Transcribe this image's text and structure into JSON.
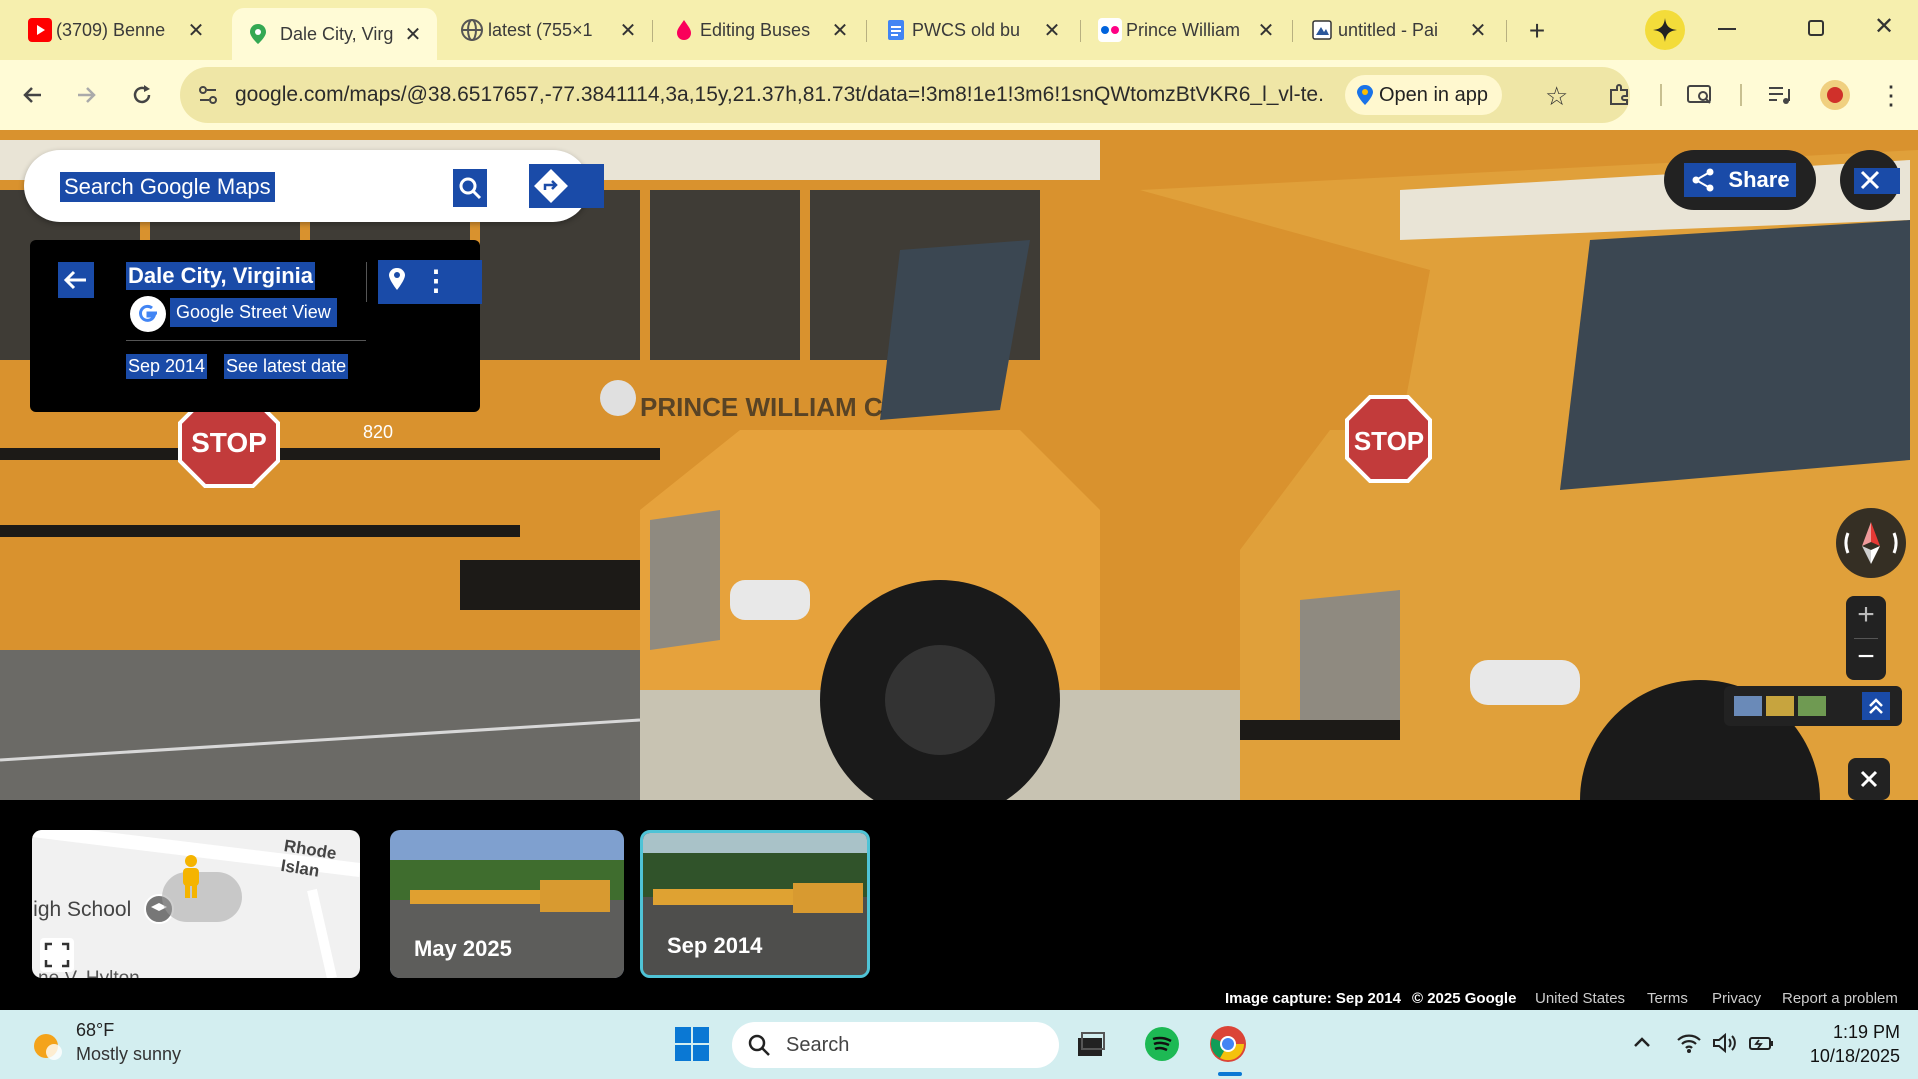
{
  "browser": {
    "tabs": [
      {
        "title": "(3709) Benne",
        "favicon": "youtube-icon",
        "color": "#ff0000"
      },
      {
        "title": "Dale City, Virg",
        "favicon": "google-maps-icon",
        "color": "#1a73e8",
        "active": true
      },
      {
        "title": "latest (755×1",
        "favicon": "globe-icon",
        "color": "#555555"
      },
      {
        "title": "Editing Buses",
        "favicon": "fandom-icon",
        "color": "#fa005a"
      },
      {
        "title": "PWCS old bu",
        "favicon": "google-docs-icon",
        "color": "#4285f4"
      },
      {
        "title": "Prince William",
        "favicon": "flickr-icon",
        "color": "#0063dc"
      },
      {
        "title": "untitled - Pai",
        "favicon": "paint-icon",
        "color": "#2b579a"
      }
    ],
    "new_tab_symbol": "+",
    "url": "google.com/maps/@38.6517657,-77.3841114,3a,15y,21.37h,81.73t/data=!3m8!1e1!3m6!1snQWtomzBtVKR6_l_vl-te...",
    "open_in_app": "Open in app"
  },
  "maps": {
    "search_placeholder": "Search Google Maps",
    "location_title": "Dale City, Virginia",
    "source": "Google Street View",
    "capture_date": "Sep 2014",
    "see_latest": "See latest date",
    "share_label": "Share",
    "scene_text": {
      "stop_left": "STOP",
      "stop_right": "STOP",
      "bus_number": "820",
      "bus_lettering": "PRINCE WILLIAM C"
    }
  },
  "filmstrip": {
    "map_thumb_labels": [
      "Rhode Islan",
      "High School",
      "ne V. Hylton"
    ],
    "thumbs": [
      {
        "label": "May 2025",
        "selected": false
      },
      {
        "label": "Sep 2014",
        "selected": true
      }
    ]
  },
  "footer": {
    "image_capture": "Image capture: Sep 2014",
    "copyright": "© 2025 Google",
    "country": "United States",
    "terms": "Terms",
    "privacy": "Privacy",
    "report": "Report a problem"
  },
  "taskbar": {
    "temperature": "68°F",
    "condition": "Mostly sunny",
    "search_placeholder": "Search",
    "time": "1:19 PM",
    "date": "10/18/2025"
  },
  "colors": {
    "tabstrip": "#f6efae",
    "toolbar": "#fffbd6",
    "highlight": "#1a4ba8",
    "bus_yellow": "#e8a63a",
    "taskbar": "#d3eef0"
  }
}
